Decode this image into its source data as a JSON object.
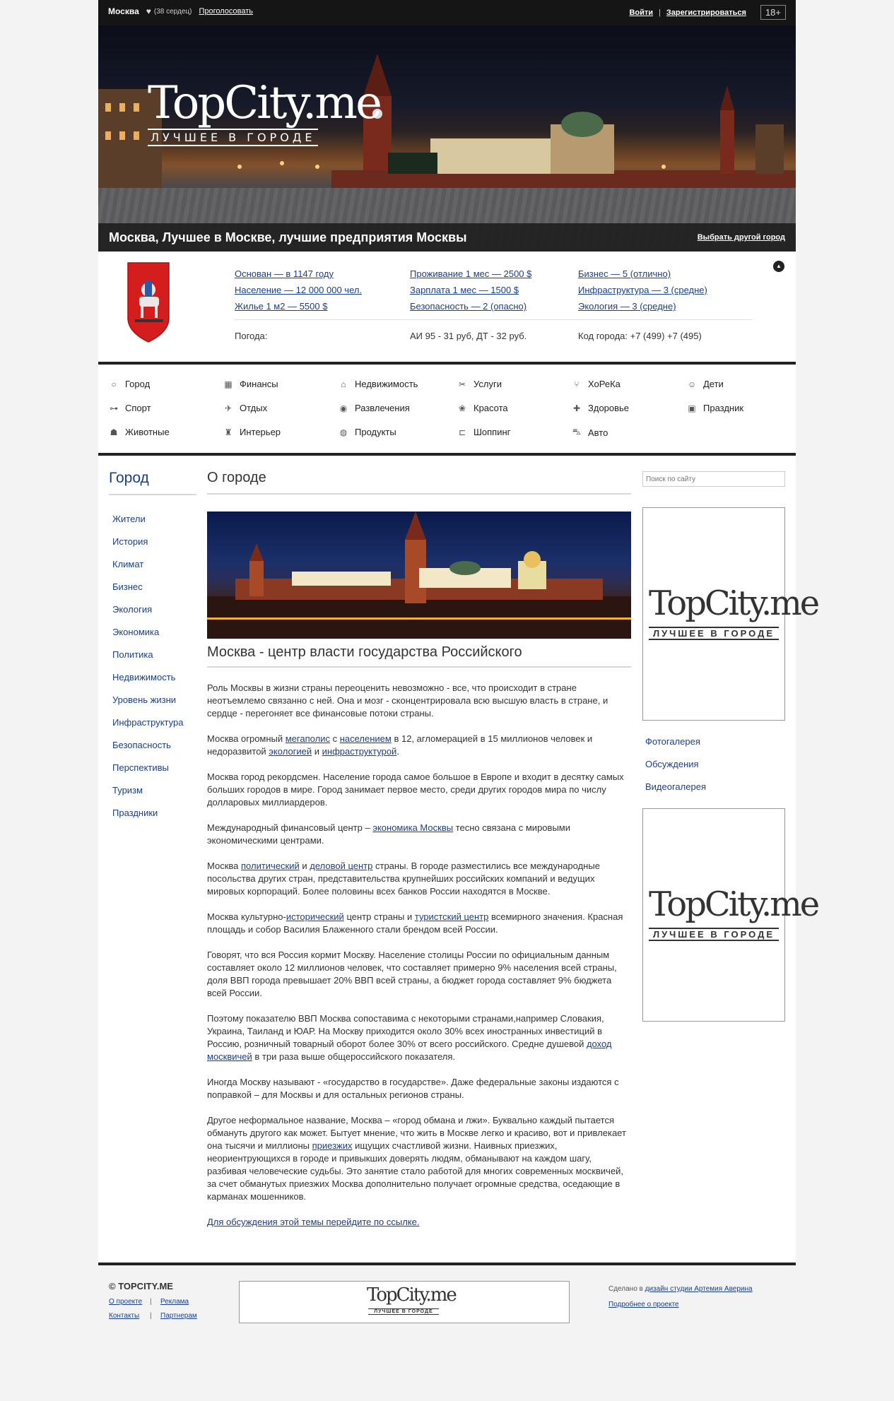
{
  "topbar": {
    "city": "Москва",
    "hearts": "(38 сердец)",
    "vote": "Проголосовать",
    "login": "Войти",
    "separator": "|",
    "register": "Зарегистрироваться",
    "age": "18+"
  },
  "header": {
    "logo_main": "TopCity.me",
    "logo_sub": "ЛУЧШЕЕ В ГОРОДЕ",
    "caption": "Москва, Лучшее в Москве, лучшие предприятия Москвы",
    "choose_city": "Выбрать другой город"
  },
  "info": {
    "col1": [
      "Основан — в 1147 году",
      "Население — 12 000 000 чел.",
      "Жилье 1 м2 — 5500 $"
    ],
    "col2": [
      "Проживание 1 мес — 2500 $",
      "Зарплата 1 мес — 1500 $",
      "Безопасность — 2 (опасно)"
    ],
    "col3": [
      "Бизнес — 5 (отлично)",
      "Инфраструктура — 3 (средне)",
      "Экология — 3 (средне)"
    ],
    "weather": "Погода:",
    "fuel": "АИ 95 - 31 руб, ДТ - 32 руб.",
    "phone_code": "Код города: +7 (499)  +7 (495)",
    "toggle": "▲"
  },
  "categories": [
    {
      "label": "Город",
      "icon": "○"
    },
    {
      "label": "Финансы",
      "icon": "▦"
    },
    {
      "label": "Недвижимость",
      "icon": "⌂"
    },
    {
      "label": "Услуги",
      "icon": "✂"
    },
    {
      "label": "ХоРеКа",
      "icon": "⑂"
    },
    {
      "label": "Дети",
      "icon": "☺"
    },
    {
      "label": "Спорт",
      "icon": "⊶"
    },
    {
      "label": "Отдых",
      "icon": "✈"
    },
    {
      "label": "Развлечения",
      "icon": "◉"
    },
    {
      "label": "Красота",
      "icon": "❀"
    },
    {
      "label": "Здоровье",
      "icon": "✚"
    },
    {
      "label": "Праздник",
      "icon": "▣"
    },
    {
      "label": "Животные",
      "icon": "☗"
    },
    {
      "label": "Интерьер",
      "icon": "♜"
    },
    {
      "label": "Продукты",
      "icon": "◍"
    },
    {
      "label": "Шоппинг",
      "icon": "⊏"
    },
    {
      "label": "Авто",
      "icon": "⛍"
    }
  ],
  "left": {
    "heading": "Город",
    "items": [
      "Жители",
      "История",
      "Климат",
      "Бизнес",
      "Экология",
      "Экономика",
      "Политика",
      "Недвижимость",
      "Уровень жизни",
      "Инфраструктура",
      "Безопасность",
      "Перспективы",
      "Туризм",
      "Праздники"
    ]
  },
  "main": {
    "title": "О городе",
    "subtitle": "Москва - центр власти государства Российского",
    "p1": "Роль Москвы в жизни страны переоценить невозможно - все, что происходит в стране неотъемлемо связанно с ней. Она и мозг - сконцентрировала всю высшую власть в стране, и сердце - перегоняет все финансовые потоки страны.",
    "p2a": "Москва огромный ",
    "p2l1": "мегаполис",
    "p2b": " с ",
    "p2l2": "населением",
    "p2c": " в 12, агломерацией в 15 миллионов человек и недоразвитой ",
    "p2l3": "экологией",
    "p2d": " и ",
    "p2l4": "инфраструктурой",
    "p2e": ".",
    "p3": "Москва город рекордсмен. Население города самое большое в Европе и входит в десятку самых больших городов в мире. Город занимает первое место, среди других городов мира по числу долларовых миллиардеров.",
    "p4a": "Международный финансовый центр – ",
    "p4l1": "экономика Москвы",
    "p4b": " тесно связана с мировыми экономическими центрами.",
    "p5a": "Москва ",
    "p5l1": "политический",
    "p5b": " и ",
    "p5l2": "деловой центр",
    "p5c": " страны. В городе разместились все международные посольства других стран, представительства крупнейших российских компаний и ведущих мировых корпораций. Более половины всех банков России находятся в Москве.",
    "p6a": "Москва культурно-",
    "p6l1": "исторический",
    "p6b": " центр страны и ",
    "p6l2": "туристский центр",
    "p6c": " всемирного значения. Красная площадь и собор Василия Блаженного стали брендом всей России.",
    "p7": "Говорят, что вся Россия кормит Москву. Население столицы России по официальным данным составляет около 12 миллионов человек, что составляет примерно 9% населения всей страны, доля ВВП города превышает 20% ВВП всей страны, а бюджет города составляет 9% бюджета всей России.",
    "p8a": "Поэтому показателю ВВП Москва сопоставима с некоторыми странами,например Словакия, Украина, Таиланд и ЮАР. На Москву приходится около 30% всех иностранных инвестиций в Россию, розничный товарный оборот более 30% от всего российского. Средне душевой ",
    "p8l1": "доход москвичей",
    "p8b": " в три раза выше общероссийского показателя.",
    "p9": "Иногда Москву называют - «государство в государстве». Даже федеральные законы издаются с поправкой – для Москвы и для остальных регионов страны.",
    "p10a": "Другое неформальное название, Москва – «город обмана и лжи». Буквально каждый пытается обмануть другого как может. Бытует мнение, что жить в Москве легко и красиво, вот и привлекает она тысячи и миллионы ",
    "p10l1": "приезжих",
    "p10b": " ищущих счастливой жизни. Наивных приезжих, неориентрующихся в городе и привыкших доверять людям, обманывают на каждом шагу, разбивая человеческие судьбы. Это занятие стало работой для многих современных москвичей, за счет обманутых приезжих Москва дополнительно получает огромные средства, оседающие в карманах мошенников.",
    "discuss": "Для обсуждения этой темы перейдите по ссылке."
  },
  "sidebar": {
    "search_placeholder": "Поиск по сайту",
    "ad_main": "TopCity.me",
    "ad_sub": "ЛУЧШЕЕ В ГОРОДЕ",
    "links": [
      "Фотогалерея",
      "Обсуждения",
      "Видеогалерея"
    ]
  },
  "footer": {
    "copyright": "© TOPCITY.ME",
    "about": "О проекте",
    "ads": "Реклама",
    "contacts": "Контакты",
    "partners": "Партнерам",
    "sep": "|",
    "banner_main": "TopCity.me",
    "banner_sub": "ЛУЧШЕЕ В ГОРОДЕ",
    "made_prefix": "Сделано в ",
    "made_link": "дизайн студии Артемия Аверина",
    "more": "Подробнее о проекте"
  }
}
